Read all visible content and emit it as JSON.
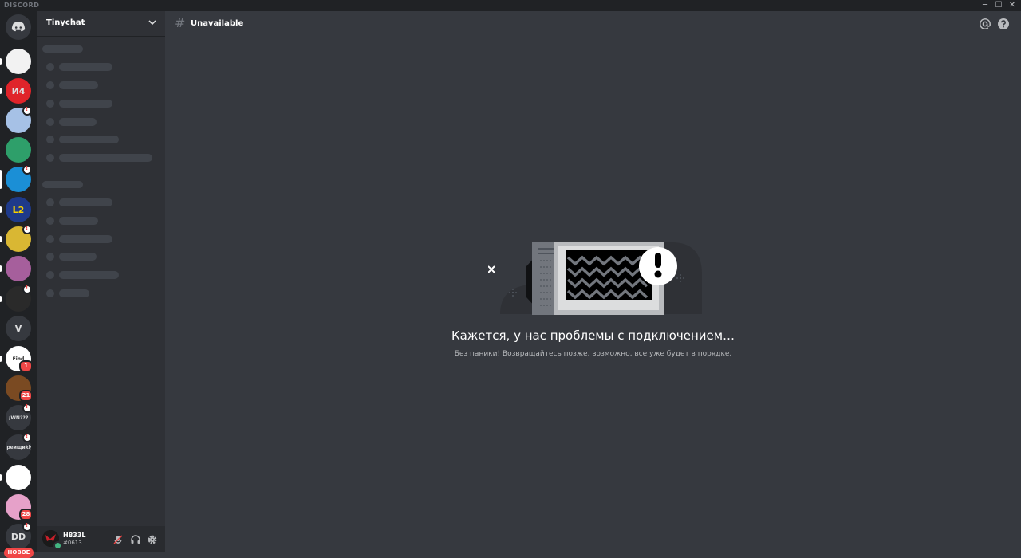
{
  "window": {
    "brand": "DISCORD",
    "controls": {
      "minimize": "─",
      "maximize": "☐",
      "close": "✕"
    }
  },
  "guilds": {
    "home_icon": "discord-logo-icon",
    "items": [
      {
        "name": "guild-eagle",
        "color": "#f2f2f2",
        "glyph": "",
        "badge": ""
      },
      {
        "name": "guild-red-logo",
        "color": "#e0242a",
        "glyph": "И4",
        "badge": ""
      },
      {
        "name": "guild-map",
        "color": "#a6c1e6",
        "glyph": "",
        "badge": "!"
      },
      {
        "name": "guild-green-card",
        "color": "#2e9f6a",
        "glyph": "",
        "badge": ""
      },
      {
        "name": "guild-eye",
        "color": "#1b8fd6",
        "glyph": "",
        "badge": "!"
      },
      {
        "name": "guild-l2",
        "color": "#1e3a8a",
        "glyph": "L2",
        "badge": ""
      },
      {
        "name": "guild-yellow",
        "color": "#d9b733",
        "glyph": "",
        "badge": "!"
      },
      {
        "name": "guild-purple",
        "color": "#a65f9c",
        "glyph": "",
        "badge": ""
      },
      {
        "name": "guild-orange-dragon",
        "color": "#2a2a2a",
        "glyph": "",
        "badge": "!"
      },
      {
        "name": "guild-v",
        "color": "#36393f",
        "glyph": "V",
        "badge": ""
      },
      {
        "name": "guild-find",
        "color": "#ffffff",
        "glyph": "Find",
        "badge": "1"
      },
      {
        "name": "guild-brown",
        "color": "#7a4a22",
        "glyph": "",
        "badge": "21"
      },
      {
        "name": "guild-jin",
        "color": "#36393f",
        "glyph": "¡WN???",
        "badge": "!"
      },
      {
        "name": "guild-frequency",
        "color": "#36393f",
        "glyph": "ереищиkly",
        "badge": "!"
      },
      {
        "name": "guild-wolf",
        "color": "#ffffff",
        "glyph": "",
        "badge": ""
      },
      {
        "name": "guild-pink",
        "color": "#e6a1c9",
        "glyph": "",
        "badge": "28"
      },
      {
        "name": "guild-dd",
        "color": "#36393f",
        "glyph": "DD",
        "badge": "!"
      }
    ],
    "new_label": "НОВОЕ"
  },
  "server": {
    "name": "Tinychat",
    "user": {
      "username": "H833L",
      "discriminator": "#0613"
    }
  },
  "channel": {
    "title": "Unavailable"
  },
  "error": {
    "title": "Кажется, у нас проблемы с подключением…",
    "subtitle": "Без паники! Возвращайтесь позже, возможно, все уже будет в порядке."
  },
  "icons": {
    "mention": "at-icon",
    "help": "help-icon",
    "mute": "mic-muted-icon",
    "deafen": "headphones-icon",
    "settings": "gear-icon"
  }
}
